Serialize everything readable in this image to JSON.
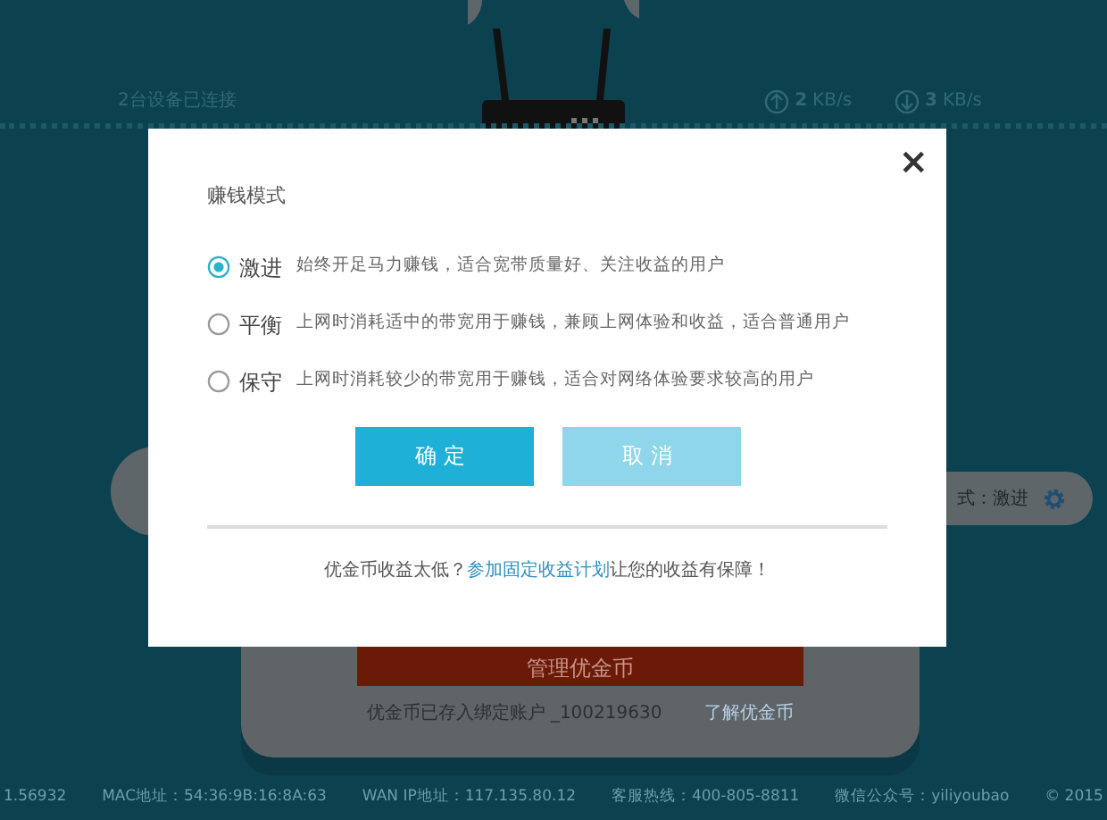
{
  "status": {
    "devices": "2台设备已连接",
    "upload": {
      "value": "2",
      "unit": "KB/s"
    },
    "download": {
      "value": "3",
      "unit": "KB/s"
    }
  },
  "mode_badge": {
    "text": "式：激进"
  },
  "coins": {
    "button": "管理优金币",
    "account": "优金币已存入绑定账户 _100219630",
    "link": "了解优金币"
  },
  "footer": [
    "1.56932",
    "MAC地址：54:36:9B:16:8A:63",
    "WAN IP地址：117.135.80.12",
    "客服热线：400-805-8811",
    "微信公众号：yiliyoubao",
    "© 2015"
  ],
  "dialog": {
    "close": "×",
    "title": "赚钱模式",
    "options": [
      {
        "label": "激进",
        "description": "始终开足马力赚钱，适合宽带质量好、关注收益的用户",
        "selected": true
      },
      {
        "label": "平衡",
        "description": "上网时消耗适中的带宽用于赚钱，兼顾上网体验和收益，适合普通用户",
        "selected": false
      },
      {
        "label": "保守",
        "description": "上网时消耗较少的带宽用于赚钱，适合对网络体验要求较高的用户",
        "selected": false
      }
    ],
    "buttons": [
      {
        "label": "确定",
        "kind": "primary"
      },
      {
        "label": "取消",
        "kind": "secondary"
      }
    ],
    "note": {
      "before": "优金币收益太低？",
      "link": "参加固定收益计划",
      "after": "让您的收益有保障！"
    }
  }
}
